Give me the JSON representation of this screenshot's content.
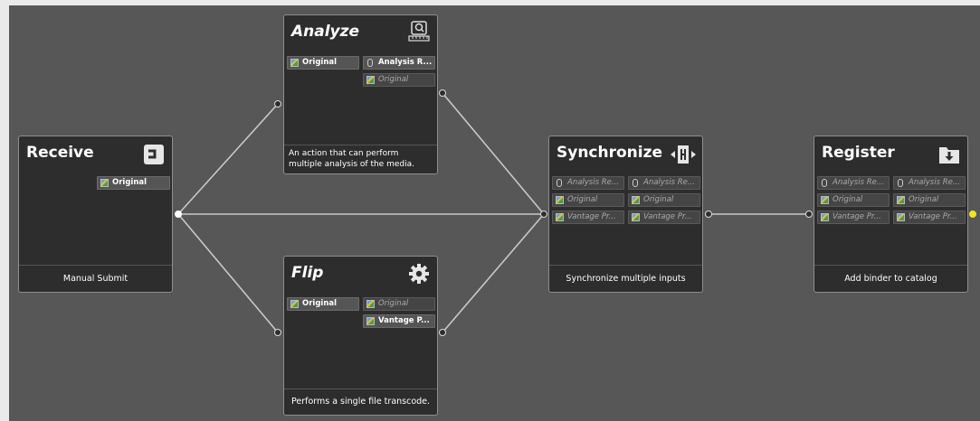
{
  "nodes": {
    "receive": {
      "title": "Receive",
      "icon": "receive-icon",
      "chips": [
        "Original"
      ],
      "footer": "Manual Submit"
    },
    "analyze": {
      "title": "Analyze",
      "icon": "analyze-icon",
      "inputs": [
        "Original"
      ],
      "outputs": [
        "Analysis R...",
        "Original"
      ],
      "description": "An action that can perform multiple analysis of the media."
    },
    "flip": {
      "title": "Flip",
      "icon": "gear-icon",
      "inputs": [
        "Original"
      ],
      "outputs": [
        "Original",
        "Vantage P..."
      ],
      "description": "Performs a single file transcode."
    },
    "synchronize": {
      "title": "Synchronize",
      "icon": "synchronize-icon",
      "left": [
        "Analysis Re...",
        "Original",
        "Vantage Pr..."
      ],
      "right": [
        "Analysis Re...",
        "Original",
        "Vantage Pr..."
      ],
      "footer": "Synchronize multiple inputs"
    },
    "register": {
      "title": "Register",
      "icon": "folder-download-icon",
      "left": [
        "Analysis Re...",
        "Original",
        "Vantage Pr..."
      ],
      "right": [
        "Analysis Re...",
        "Original",
        "Vantage Pr..."
      ],
      "footer": "Add binder to catalog"
    }
  },
  "colors": {
    "canvas": "#575757",
    "node": "#2d2d2d",
    "wire": "#c8c8c8",
    "active_port": "#f3e51d"
  }
}
